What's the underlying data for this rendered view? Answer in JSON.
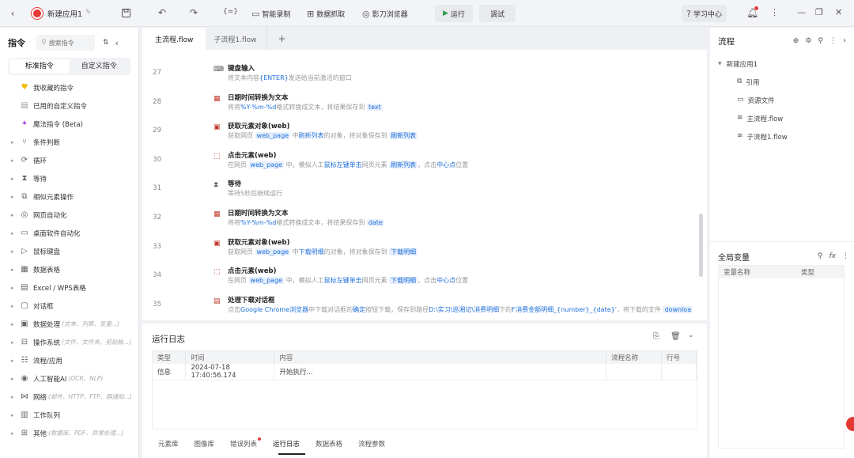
{
  "titlebar": {
    "app_name": "新建应用1",
    "btn_record": "智能录制",
    "btn_capture": "数据抓取",
    "btn_browser": "影刀浏览器",
    "btn_run": "运行",
    "btn_debug": "调试",
    "btn_learn": "学习中心"
  },
  "left": {
    "title": "指令",
    "search_placeholder": "搜索指令",
    "tab_standard": "标准指令",
    "tab_custom": "自定义指令",
    "top_items": [
      {
        "label": "我收藏的指令"
      },
      {
        "label": "已用的自定义指令"
      },
      {
        "label": "魔法指令 (Beta)"
      }
    ],
    "categories": [
      {
        "label": "条件判断",
        "sub": ""
      },
      {
        "label": "循环",
        "sub": ""
      },
      {
        "label": "等待",
        "sub": ""
      },
      {
        "label": "相似元素操作",
        "sub": ""
      },
      {
        "label": "网页自动化",
        "sub": ""
      },
      {
        "label": "桌面软件自动化",
        "sub": ""
      },
      {
        "label": "鼠标键盘",
        "sub": ""
      },
      {
        "label": "数据表格",
        "sub": ""
      },
      {
        "label": "Excel / WPS表格",
        "sub": ""
      },
      {
        "label": "对话框",
        "sub": ""
      },
      {
        "label": "数据处理",
        "sub": "(文本、列表、变量...)"
      },
      {
        "label": "操作系统",
        "sub": "(文件、文件夹、剪贴板...)"
      },
      {
        "label": "流程/应用",
        "sub": ""
      },
      {
        "label": "人工智能AI",
        "sub": "(OCR、NLP)"
      },
      {
        "label": "网络",
        "sub": "(邮件、HTTP、FTP、群通知...)"
      },
      {
        "label": "工作队列",
        "sub": ""
      },
      {
        "label": "其他",
        "sub": "(数据库、PDF、异常处理...)"
      }
    ]
  },
  "editor": {
    "tabs": [
      {
        "label": "主流程.flow"
      },
      {
        "label": "子流程1.flow"
      }
    ],
    "add_tab": "+",
    "rows": [
      {
        "line": "27",
        "title": "键盘输入",
        "desc": [
          {
            "t": "将文本内容"
          },
          {
            "t": "{ENTER}",
            "h": 1
          },
          {
            "t": "发送给当前激活的窗口"
          }
        ]
      },
      {
        "line": "28",
        "title": "日期时间转换为文本",
        "desc": [
          {
            "t": "将将"
          },
          {
            "t": "%Y-%m-%d",
            "h": 1
          },
          {
            "t": "格式转换成文本，将结果保存到 "
          },
          {
            "t": "text",
            "tag": 1
          }
        ]
      },
      {
        "line": "29",
        "title": "获取元素对象(web)",
        "desc": [
          {
            "t": "获取网页 "
          },
          {
            "t": "web_page",
            "tag": 1
          },
          {
            "t": " 中"
          },
          {
            "t": "刷新列表",
            "h": 1
          },
          {
            "t": "的对象，将对象保存到 "
          },
          {
            "t": "刷新列表",
            "tag": 1
          }
        ]
      },
      {
        "line": "30",
        "title": "点击元素(web)",
        "desc": [
          {
            "t": "在网页 "
          },
          {
            "t": "web_page",
            "tag": 1
          },
          {
            "t": " 中，模拟人工"
          },
          {
            "t": "鼠标左键单击",
            "h": 1
          },
          {
            "t": "网页元素 "
          },
          {
            "t": "刷新列表",
            "tag": 1
          },
          {
            "t": "，点击"
          },
          {
            "t": "中心点",
            "h": 1
          },
          {
            "t": "位置"
          }
        ]
      },
      {
        "line": "31",
        "title": "等待",
        "desc": [
          {
            "t": "等待5秒后继续运行"
          }
        ]
      },
      {
        "line": "32",
        "title": "日期时间转换为文本",
        "desc": [
          {
            "t": "将将"
          },
          {
            "t": "%Y-%m-%d",
            "h": 1
          },
          {
            "t": "格式转换成文本，将结果保存到 "
          },
          {
            "t": "date",
            "tag": 1
          }
        ]
      },
      {
        "line": "33",
        "title": "获取元素对象(web)",
        "desc": [
          {
            "t": "获取网页 "
          },
          {
            "t": "web_page",
            "tag": 1
          },
          {
            "t": " 中"
          },
          {
            "t": "下载明细",
            "h": 1
          },
          {
            "t": "的对象，将对象保存到 "
          },
          {
            "t": "下载明细",
            "tag": 1
          }
        ]
      },
      {
        "line": "34",
        "title": "点击元素(web)",
        "desc": [
          {
            "t": "在网页 "
          },
          {
            "t": "web_page",
            "tag": 1
          },
          {
            "t": " 中，模拟人工"
          },
          {
            "t": "鼠标左键单击",
            "h": 1
          },
          {
            "t": "网页元素 "
          },
          {
            "t": "下载明细",
            "tag": 1
          },
          {
            "t": "，点击"
          },
          {
            "t": "中心点",
            "h": 1
          },
          {
            "t": "位置"
          }
        ]
      },
      {
        "line": "35",
        "title": "处理下载对话框",
        "desc": [
          {
            "t": "点击"
          },
          {
            "t": "Google Chrome浏览器",
            "h": 1
          },
          {
            "t": "中下载对话框的"
          },
          {
            "t": "确定",
            "h": 1
          },
          {
            "t": "按钮下载，保存到路径"
          },
          {
            "t": "D:\\实习\\巡湘记\\消费明细",
            "h": 1
          },
          {
            "t": "下的"
          },
          {
            "t": "f'消费金额明细_{number}_{date}'",
            "h": 1
          },
          {
            "t": "，将下载的文件 "
          },
          {
            "t": "downloa",
            "tag": 1
          }
        ]
      }
    ]
  },
  "log": {
    "title": "运行日志",
    "columns": [
      "类型",
      "时间",
      "内容",
      "流程名称",
      "行号"
    ],
    "rows": [
      {
        "type": "信息",
        "time": "2024-07-18 17:40:56.174",
        "content": "开始执行...",
        "flow": "",
        "line": ""
      }
    ],
    "bottom_tabs": [
      {
        "label": "元素库"
      },
      {
        "label": "图像库"
      },
      {
        "label": "错误列表"
      },
      {
        "label": "运行日志"
      },
      {
        "label": "数据表格"
      },
      {
        "label": "流程参数"
      }
    ]
  },
  "right": {
    "title": "流程",
    "root": "新建应用1",
    "items": [
      {
        "label": "引用"
      },
      {
        "label": "资源文件"
      },
      {
        "label": "主流程.flow"
      },
      {
        "label": "子流程1.flow"
      }
    ],
    "vars_title": "全局变量",
    "var_columns": [
      "变量名称",
      "类型"
    ]
  },
  "colors": {
    "accent": "#1e6fd9",
    "danger": "#e53935",
    "run_green": "#2e9e4f"
  }
}
